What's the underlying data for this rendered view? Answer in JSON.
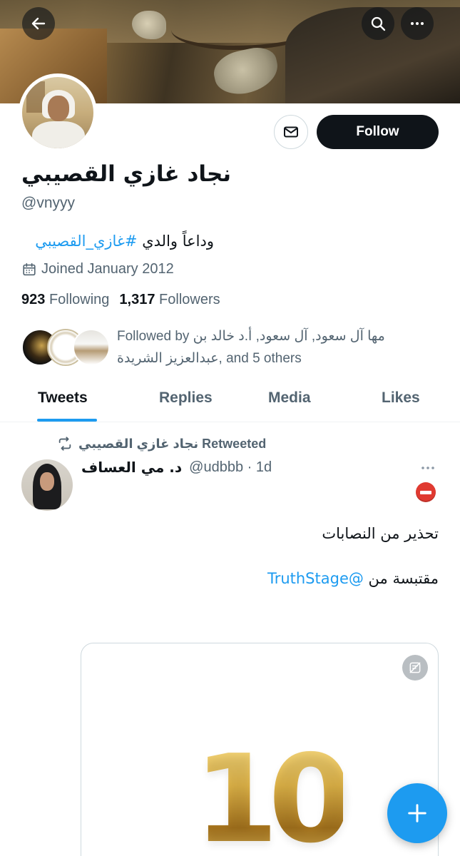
{
  "profile": {
    "name": "نجاد غازي القصيبي",
    "handle": "@vnyyy",
    "bio_text": "وداعاً والدي ",
    "bio_hashtag": "#غازي_القصيبي",
    "joined": "Joined January 2012",
    "following_count": "923",
    "following_label": "Following",
    "followers_count": "1,317",
    "followers_label": "Followers",
    "followed_by_line1": "Followed by مها آل سعود, آل سعود, أ.د خالد بن",
    "followed_by_line2": "عبدالعزيز الشريدة, and 5 others"
  },
  "actions": {
    "follow_label": "Follow"
  },
  "tabs": [
    "Tweets",
    "Replies",
    "Media",
    "Likes"
  ],
  "active_tab": "Tweets",
  "tweet": {
    "retweet_label": "نجاد غازي القصيبي Retweeted",
    "author_name": "د. مي العساف",
    "author_meta": "@udbbb · 1d",
    "line1": "تحذير من النصابات",
    "line2_prefix": "مقتبسة من ",
    "line2_mention": "@TruthStage",
    "media_text": "10"
  },
  "icons": [
    "back-arrow-icon",
    "search-icon",
    "more-icon",
    "mail-icon",
    "calendar-icon",
    "retweet-icon",
    "no-entry-icon",
    "content-warning-icon",
    "plus-icon"
  ],
  "colors": {
    "accent": "#1d9bf0",
    "text": "#0f1419",
    "muted": "#536471",
    "follow_bg": "#0f1419"
  }
}
